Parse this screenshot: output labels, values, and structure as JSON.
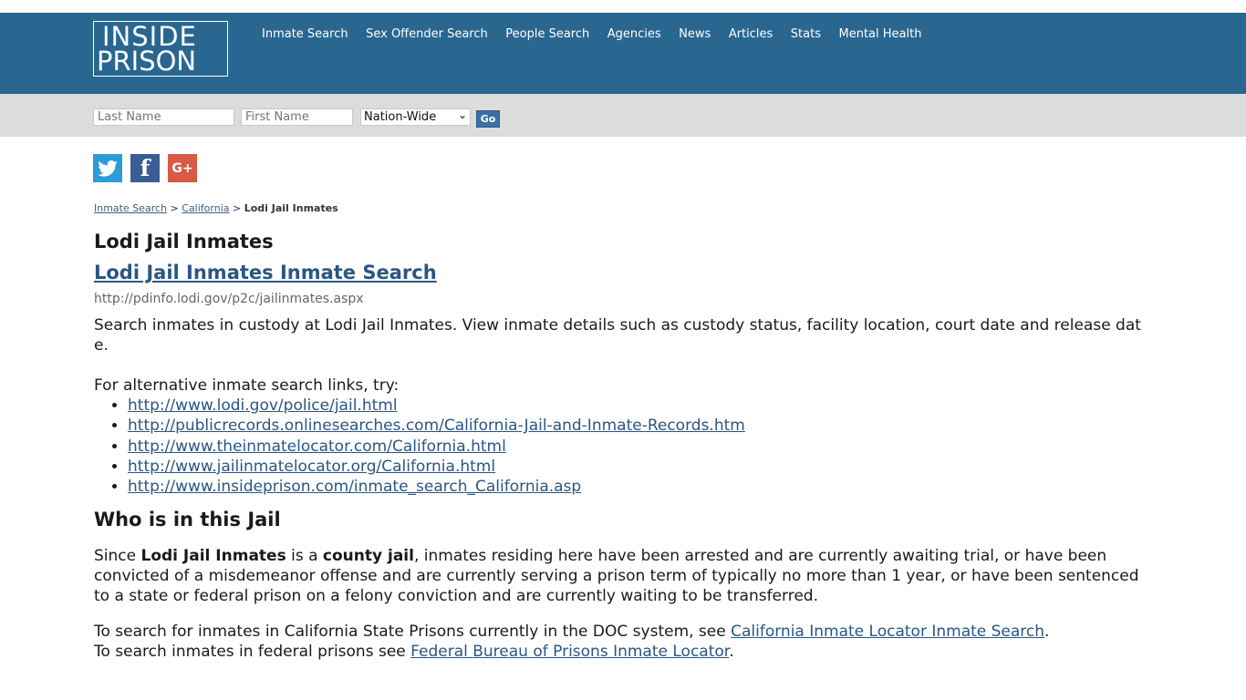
{
  "header": {
    "logo_line1": "INSIDE",
    "logo_line2": "PRISON",
    "nav": [
      "Inmate Search",
      "Sex Offender Search",
      "People Search",
      "Agencies",
      "News",
      "Articles",
      "Stats",
      "Mental Health"
    ]
  },
  "search": {
    "last_name_placeholder": "Last Name",
    "first_name_placeholder": "First Name",
    "scope_selected": "Nation-Wide",
    "go_label": "Go"
  },
  "social": {
    "twitter": "twitter-icon",
    "facebook": "facebook-icon",
    "google": "google-plus-icon",
    "fb_glyph": "f",
    "g_glyph": "G+"
  },
  "breadcrumb": {
    "item1": "Inmate Search",
    "sep1": ">",
    "item2": "California",
    "sep2": ">",
    "current": "Lodi Jail Inmates"
  },
  "main": {
    "title": "Lodi Jail Inmates",
    "link_title": "Lodi Jail Inmates Inmate Search",
    "url": "http://pdinfo.lodi.gov/p2c/jailinmates.aspx",
    "description": "Search inmates in custody at Lodi Jail Inmates. View inmate details such as custody status, facility location, court date and release date.",
    "alt_intro": "For alternative inmate search links, try:",
    "alt_links": [
      "http://www.lodi.gov/police/jail.html",
      "http://publicrecords.onlinesearches.com/California-Jail-and-Inmate-Records.htm",
      "http://www.theinmatelocator.com/California.html",
      "http://www.jailinmatelocator.org/California.html",
      "http://www.insideprison.com/inmate_search_California.asp"
    ],
    "who_heading": "Who is in this Jail",
    "who_p1_since": "Since ",
    "who_p1_name": "Lodi Jail Inmates",
    "who_p1_is_a": " is a ",
    "who_p1_type": "county jail",
    "who_p1_rest": ", inmates residing here have been arrested and are currently awaiting trial, or have been convicted of a misdemeanor offense and are currently serving a prison term of typically no more than 1 year, or have been sentenced to a state or federal prison on a felony conviction and are currently waiting to be transferred.",
    "state_text": "To search for inmates in California State Prisons currently in the DOC system, see ",
    "state_link": "California Inmate Locator Inmate Search",
    "state_end": ".",
    "fed_text": "To search inmates in federal prisons see ",
    "fed_link": "Federal Bureau of Prisons Inmate Locator",
    "fed_end": "."
  }
}
